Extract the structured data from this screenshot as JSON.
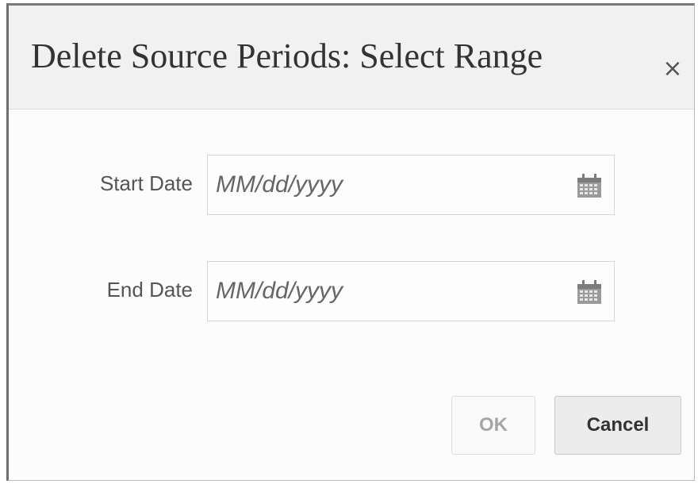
{
  "dialog": {
    "title": "Delete Source Periods: Select Range",
    "close_glyph": "×"
  },
  "form": {
    "start_date": {
      "label": "Start Date",
      "placeholder": "MM/dd/yyyy",
      "value": "",
      "icon": "calendar-icon"
    },
    "end_date": {
      "label": "End Date",
      "placeholder": "MM/dd/yyyy",
      "value": "",
      "icon": "calendar-icon"
    }
  },
  "buttons": {
    "ok_label": "OK",
    "ok_enabled": false,
    "cancel_label": "Cancel"
  }
}
